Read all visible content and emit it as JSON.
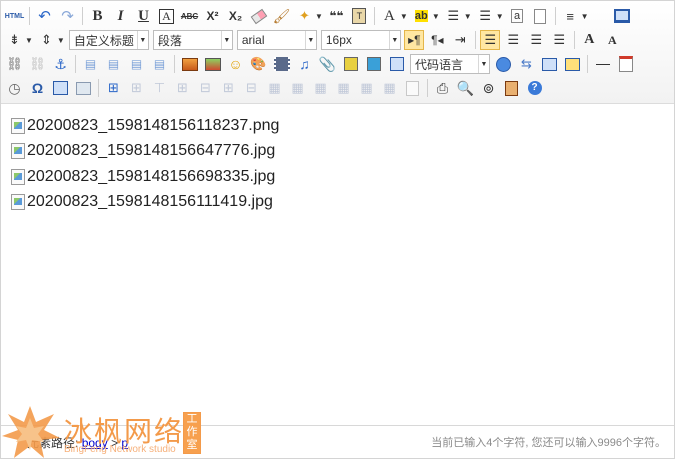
{
  "toolbar": {
    "html_label": "HTML",
    "bold": "B",
    "italic": "I",
    "underline": "U",
    "fontborder": "A",
    "strike": "ABC",
    "superscript": "X²",
    "subscript": "X₂",
    "quote_mark": "❝❝",
    "forecolor": "A",
    "backcolor": "ab",
    "inline_code": "a",
    "heading_select": "自定义标题",
    "paragraph_select": "段落",
    "font_select": "arial",
    "size_select": "16px",
    "code_language_select": "代码语言",
    "font_up": "A",
    "font_down": "A"
  },
  "content": {
    "images": [
      "20200823_1598148156118237.png",
      "20200823_1598148156647776.jpg",
      "20200823_1598148156698335.jpg",
      "20200823_1598148156111419.jpg"
    ]
  },
  "statusbar": {
    "path_label": "元素路径:",
    "path_body": "body",
    "path_sep": ">",
    "path_p": "p",
    "word_count": "当前已输入4个字符, 您还可以输入9996个字符。"
  },
  "watermark": {
    "cn": "冰枫网络",
    "en": "BingFeng Network studio",
    "badge": "工作室"
  },
  "colors": {
    "accent_active": "#ffe7a2",
    "brand_orange": "#f39a4a"
  }
}
